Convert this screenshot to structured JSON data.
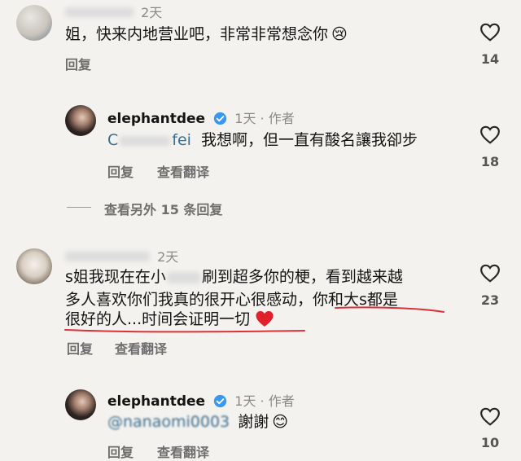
{
  "comments": [
    {
      "time": "2天",
      "text": "姐，快来内地营业吧，非常非常想念你",
      "emoji": "😢",
      "reply": "回复",
      "likes": "14"
    },
    {
      "username": "elephantdee",
      "time": "1天 · 作者",
      "mention": "fei",
      "text": "我想啊，但一直有酸名讓我卻步",
      "reply": "回复",
      "translate": "查看翻译",
      "likes": "18"
    },
    {
      "time": "2天",
      "text_line1_a": "s姐我现在在小",
      "text_line1_b": "刷到超多你的梗，看到越来越",
      "text_line2_a": "多人喜欢你们我真的很开心很感动，",
      "text_line2_b": "你和大s都是",
      "text_line3": "很好的人...时间会证明一切",
      "reply": "回复",
      "translate": "查看翻译",
      "likes": "23"
    },
    {
      "username": "elephantdee",
      "time": "1天 · 作者",
      "mention": "@nanaomi0003",
      "text": "謝謝",
      "emoji": "😊",
      "reply": "回复",
      "translate": "查看翻译",
      "likes": "10"
    }
  ],
  "view_more": "查看另外 15 条回复",
  "colors": {
    "background": "#f3f2ef",
    "underline": "#d9323a",
    "verified": "#3897f0",
    "heart_red": "#e0202a"
  }
}
